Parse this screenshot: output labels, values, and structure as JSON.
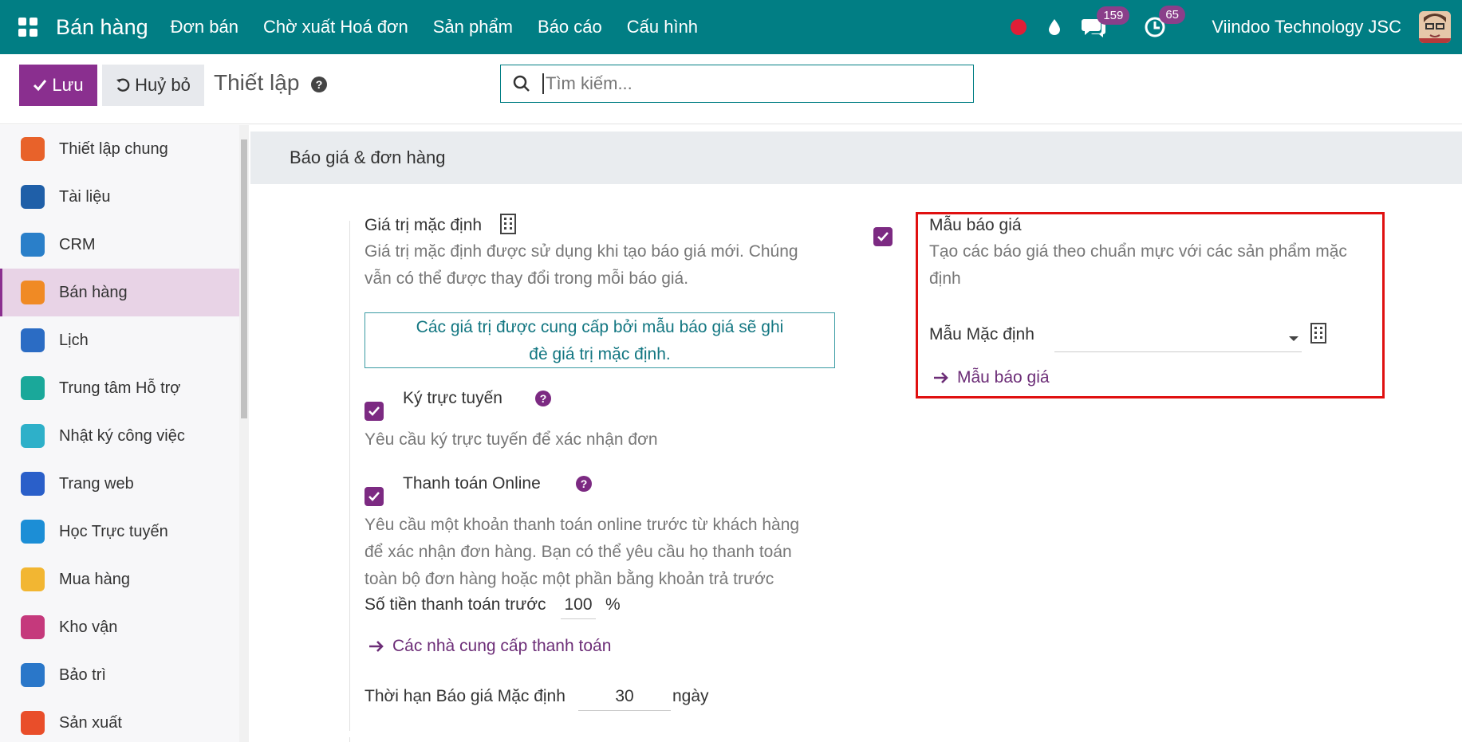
{
  "navbar": {
    "brand": "Bán hàng",
    "menu": [
      "Đơn bán",
      "Chờ xuất Hoá đơn",
      "Sản phẩm",
      "Báo cáo",
      "Cấu hình"
    ],
    "chat_count": "159",
    "activity_count": "65",
    "company": "Viindoo Technology JSC",
    "colors": {
      "bar": "#017e84",
      "badge": "#8a3f8a"
    }
  },
  "control": {
    "save_label": "Lưu",
    "discard_label": "Huỷ bỏ",
    "title": "Thiết lập",
    "search_placeholder": "Tìm kiếm..."
  },
  "sidebar": {
    "items": [
      {
        "label": "Thiết lập chung",
        "icon": "settings-icon",
        "color": "#e8622a"
      },
      {
        "label": "Tài liệu",
        "icon": "folder-icon",
        "color": "#1f5fa8"
      },
      {
        "label": "CRM",
        "icon": "crm-icon",
        "color": "#2a7fc9"
      },
      {
        "label": "Bán hàng",
        "icon": "sales-chart-icon",
        "color": "#f08a24",
        "active": true
      },
      {
        "label": "Lịch",
        "icon": "calendar-icon",
        "color": "#2b6cc4"
      },
      {
        "label": "Trung tâm Hỗ trợ",
        "icon": "helpdesk-icon",
        "color": "#1aa89a"
      },
      {
        "label": "Nhật ký công việc",
        "icon": "timesheet-icon",
        "color": "#2eb0c9"
      },
      {
        "label": "Trang web",
        "icon": "website-icon",
        "color": "#2a5fc9"
      },
      {
        "label": "Học Trực tuyến",
        "icon": "elearning-icon",
        "color": "#1c8ed6"
      },
      {
        "label": "Mua hàng",
        "icon": "purchase-card-icon",
        "color": "#f2b632"
      },
      {
        "label": "Kho vận",
        "icon": "inventory-box-icon",
        "color": "#c5397c"
      },
      {
        "label": "Bảo trì",
        "icon": "wrench-icon",
        "color": "#2a77c9"
      },
      {
        "label": "Sản xuất",
        "icon": "manufacturing-icon",
        "color": "#e94e2a"
      }
    ]
  },
  "main": {
    "section_title": "Báo giá & đơn hàng",
    "default_values": {
      "title": "Giá trị mặc định",
      "desc_lines": [
        "Giá trị mặc định được sử dụng khi tạo báo giá mới. Chúng",
        "vẫn có thể được thay đổi trong mỗi báo giá."
      ],
      "info_lines": [
        "Các giá trị được cung cấp bởi mẫu báo giá sẽ ghi",
        "đè giá trị mặc định."
      ]
    },
    "online_sign": {
      "title": "Ký trực tuyến",
      "desc": "Yêu cầu ký trực tuyến để xác nhận đơn"
    },
    "online_payment": {
      "title": "Thanh toán Online",
      "desc_lines": [
        "Yêu cầu một khoản thanh toán online trước từ khách hàng",
        "để xác nhận đơn hàng. Bạn có thể yêu cầu họ thanh toán",
        "toàn bộ đơn hàng hoặc một phần bằng khoản trả trước"
      ],
      "prepay_label": "Số tiền thanh toán trước",
      "prepay_value": "100",
      "prepay_unit": "%",
      "link": "Các nhà cung cấp thanh toán"
    },
    "validity": {
      "label": "Thời hạn Báo giá Mặc định",
      "value": "30",
      "unit": "ngày"
    },
    "quotation_templates": {
      "title": "Mẫu báo giá",
      "desc_lines": [
        "Tạo các báo giá theo chuẩn mực với các sản phẩm mặc",
        "định"
      ],
      "default_label": "Mẫu Mặc định",
      "default_value": "",
      "link": "Mẫu báo giá"
    }
  }
}
